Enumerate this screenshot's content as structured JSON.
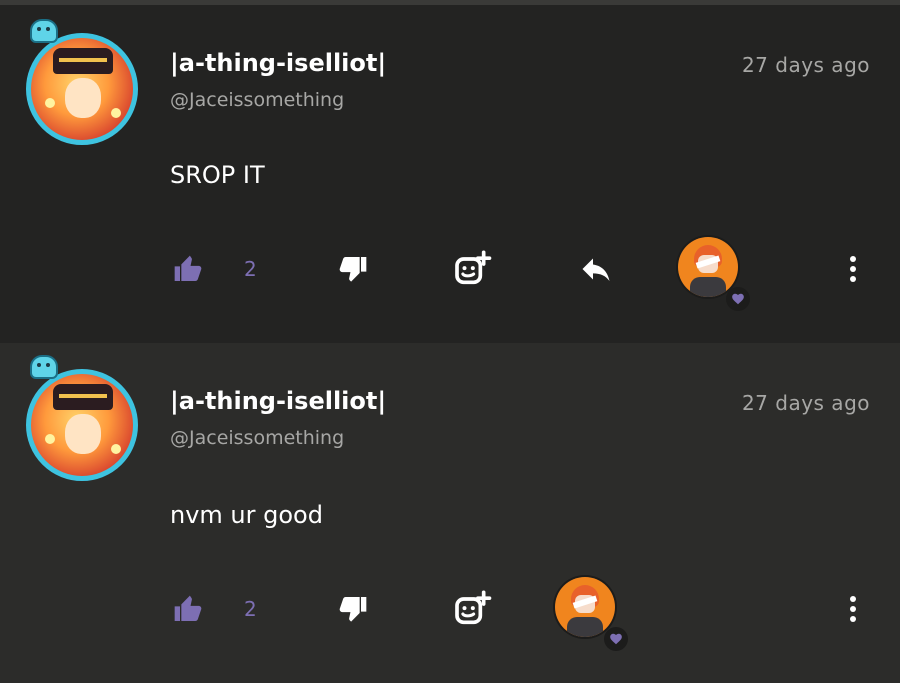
{
  "comments": [
    {
      "username": "|a-thing-iselliot|",
      "handle": "@Jaceissomething",
      "time": "27 days ago",
      "text": "SROP IT",
      "like_count": "2",
      "has_reply": true
    },
    {
      "username": "|a-thing-iselliot|",
      "handle": "@Jaceissomething",
      "time": "27 days ago",
      "text": "nvm ur good",
      "like_count": "2",
      "has_reply": false
    }
  ],
  "icons": {
    "like": "thumbs-up-icon",
    "dislike": "thumbs-down-icon",
    "reaction": "add-reaction-icon",
    "reply": "reply-icon",
    "more": "more-vertical-icon",
    "heart": "heart-icon"
  },
  "colors": {
    "background": "#232322",
    "background_alt": "#2c2c2a",
    "accent": "#7d6fb3",
    "text": "#ffffff",
    "muted": "#a7a7a5",
    "avatar_ring": "#3ec3e0",
    "mini_avatar": "#f0851e"
  }
}
